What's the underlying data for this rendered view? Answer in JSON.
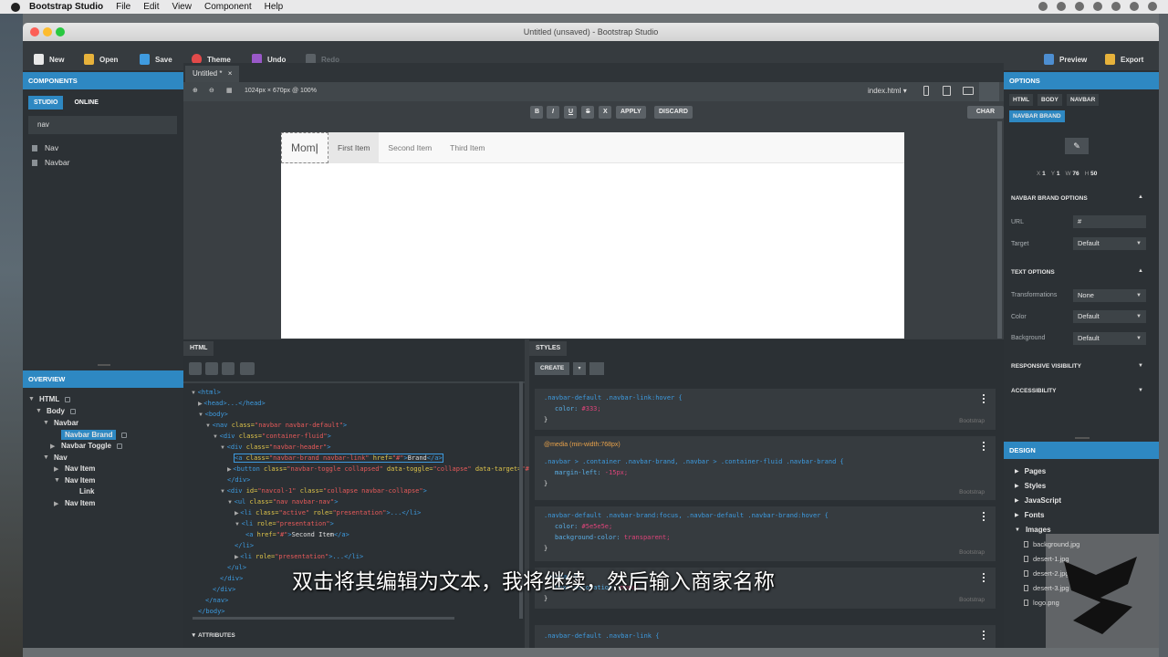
{
  "menubar": {
    "app": "Bootstrap Studio",
    "items": [
      "File",
      "Edit",
      "View",
      "Component",
      "Help"
    ]
  },
  "window": {
    "title": "Untitled (unsaved) - Bootstrap Studio"
  },
  "toolbar": {
    "new": "New",
    "open": "Open",
    "save": "Save",
    "theme": "Theme",
    "undo": "Undo",
    "redo": "Redo",
    "preview": "Preview",
    "export": "Export"
  },
  "components": {
    "header": "COMPONENTS",
    "tabs": [
      "STUDIO",
      "ONLINE"
    ],
    "search_value": "nav",
    "items": [
      "Nav",
      "Navbar"
    ]
  },
  "overview": {
    "header": "OVERVIEW",
    "tree": [
      "HTML",
      "Body",
      "Navbar",
      "Navbar Brand",
      "Navbar Toggle",
      "Nav",
      "Nav Item",
      "Nav Item",
      "Link",
      "Nav Item"
    ]
  },
  "editor": {
    "tab": "Untitled *",
    "size": "1024px × 670px @ 100%",
    "file": "index.html",
    "fmt": [
      "B",
      "I",
      "U",
      "S",
      "X"
    ],
    "apply": "APPLY",
    "discard": "DISCARD",
    "char_input": "CHAR INPUT"
  },
  "preview": {
    "brand": "Mom",
    "items": [
      "First Item",
      "Second Item",
      "Third Item"
    ]
  },
  "html_panel": {
    "tab": "HTML",
    "lines": [
      [
        "<html>"
      ],
      [
        "<head>",
        "...",
        "</head>"
      ],
      [
        "<body>"
      ],
      [
        "<nav ",
        "class=",
        "\"navbar navbar-default\"",
        ">"
      ],
      [
        "<div ",
        "class=",
        "\"container-fluid\"",
        ">"
      ],
      [
        "<div ",
        "class=",
        "\"navbar-header\"",
        ">"
      ],
      [
        "<a ",
        "class=",
        "\"navbar-brand navbar-link\"",
        " href=",
        "\"#\"",
        ">",
        "Brand",
        "</a>"
      ],
      [
        "<button ",
        "class=",
        "\"navbar-toggle collapsed\"",
        " data-toggle=",
        "\"collapse\"",
        " data-target=",
        "\"#n"
      ],
      [
        "</div>"
      ],
      [
        "<div ",
        "id=",
        "\"navcol-1\"",
        " class=",
        "\"collapse navbar-collapse\"",
        ">"
      ],
      [
        "<ul ",
        "class=",
        "\"nav navbar-nav\"",
        ">"
      ],
      [
        "<li ",
        "class=",
        "\"active\"",
        " role=",
        "\"presentation\"",
        ">...</li>"
      ],
      [
        "<li ",
        "role=",
        "\"presentation\"",
        ">"
      ],
      [
        "<a ",
        "href=",
        "\"#\"",
        ">",
        "Second Item",
        "</a>"
      ],
      [
        "</li>"
      ],
      [
        "<li ",
        "role=",
        "\"presentation\"",
        ">...</li>"
      ],
      [
        "</ul>"
      ],
      [
        "</div>"
      ],
      [
        "</div>"
      ],
      [
        "</nav>"
      ],
      [
        "</body>"
      ]
    ],
    "attributes": "ATTRIBUTES"
  },
  "styles_panel": {
    "tab": "STYLES",
    "create": "CREATE",
    "source": "Bootstrap",
    "b1_sel": ".navbar-default .navbar-link:hover {",
    "b1_prop": "color:",
    "b1_val": "#333;",
    "media": "@media (min-width:768px)",
    "b2_sel": ".navbar > .container .navbar-brand, .navbar > .container-fluid .navbar-brand {",
    "b2_prop": "margin-left:",
    "b2_val": "-15px;",
    "b3_sel": ".navbar-default .navbar-brand:focus, .navbar-default .navbar-brand:hover {",
    "b3_prop": "color:",
    "b3_val": "#5e5e5e;",
    "b3_prop2": "background-color:",
    "b3_val2": "transparent;",
    "b4_sel": ".navbar-b",
    "b4_prop": "text-decoration:",
    "b4_val": "none;",
    "b5_sel": ".navbar-default .navbar-link {",
    "close": "}"
  },
  "options": {
    "header": "OPTIONS",
    "tabs": [
      "HTML",
      "BODY",
      "NAVBAR"
    ],
    "active_tab": "NAVBAR BRAND",
    "x": "1",
    "y": "1",
    "w": "76",
    "h": "50",
    "brand_head": "NAVBAR BRAND OPTIONS",
    "url_label": "URL",
    "url_value": "#",
    "target_label": "Target",
    "target_value": "Default",
    "text_head": "TEXT OPTIONS",
    "transf_label": "Transformations",
    "transf_value": "None",
    "color_label": "Color",
    "color_value": "Default",
    "bg_label": "Background",
    "bg_value": "Default",
    "resp": "RESPONSIVE VISIBILITY",
    "access": "ACCESSIBILITY"
  },
  "design": {
    "header": "DESIGN",
    "items": [
      "Pages",
      "Styles",
      "JavaScript",
      "Fonts",
      "Images"
    ],
    "images": [
      "background.jpg",
      "desert-1.jpg",
      "desert-2.jpg",
      "desert-3.jpg",
      "logo.png"
    ]
  },
  "subtitle": "双击将其编辑为文本，我将继续，然后输入商家名称",
  "colors": {
    "accent": "#2e88c2",
    "panel": "#2c3135",
    "code_tag": "#3d9be0",
    "code_attr": "#e0c54a",
    "code_val": "#e85a5a"
  }
}
